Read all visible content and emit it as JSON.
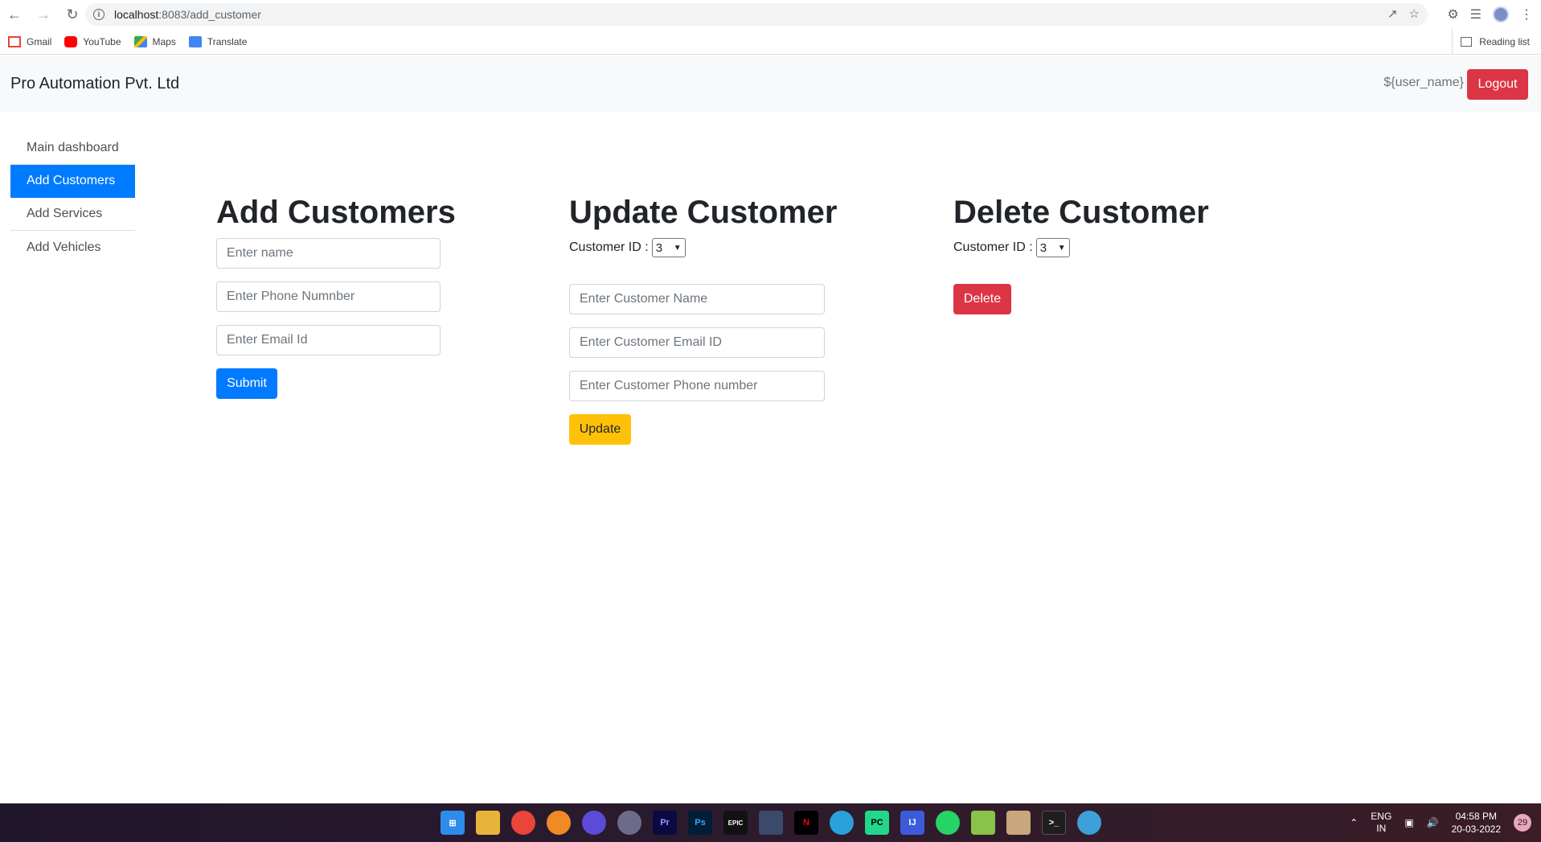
{
  "browser": {
    "url_host": "localhost",
    "url_path": ":8083/add_customer",
    "bookmarks": [
      "Gmail",
      "YouTube",
      "Maps",
      "Translate"
    ],
    "reading_list": "Reading list"
  },
  "navbar": {
    "brand": "Pro Automation Pvt. Ltd",
    "username": "${user_name}",
    "logout_label": "Logout"
  },
  "sidebar": {
    "items": [
      {
        "label": "Main dashboard"
      },
      {
        "label": "Add Customers"
      },
      {
        "label": "Add Services"
      },
      {
        "label": "Add Vehicles"
      }
    ]
  },
  "add_customers": {
    "title": "Add Customers",
    "name_placeholder": "Enter name",
    "phone_placeholder": "Enter Phone Numnber",
    "email_placeholder": "Enter Email Id",
    "submit_label": "Submit"
  },
  "update_customer": {
    "title": "Update Customer",
    "id_label": "Customer ID :",
    "id_value": "3",
    "name_placeholder": "Enter Customer Name",
    "email_placeholder": "Enter Customer Email ID",
    "phone_placeholder": "Enter Customer Phone number",
    "update_label": "Update"
  },
  "delete_customer": {
    "title": "Delete Customer",
    "id_label": "Customer ID :",
    "id_value": "3",
    "delete_label": "Delete"
  },
  "taskbar": {
    "lang_top": "ENG",
    "lang_bottom": "IN",
    "time": "04:58 PM",
    "date": "20-03-2022",
    "notifications": "29"
  },
  "colors": {
    "primary": "#007bff",
    "danger": "#dc3545",
    "warning": "#ffc107"
  }
}
